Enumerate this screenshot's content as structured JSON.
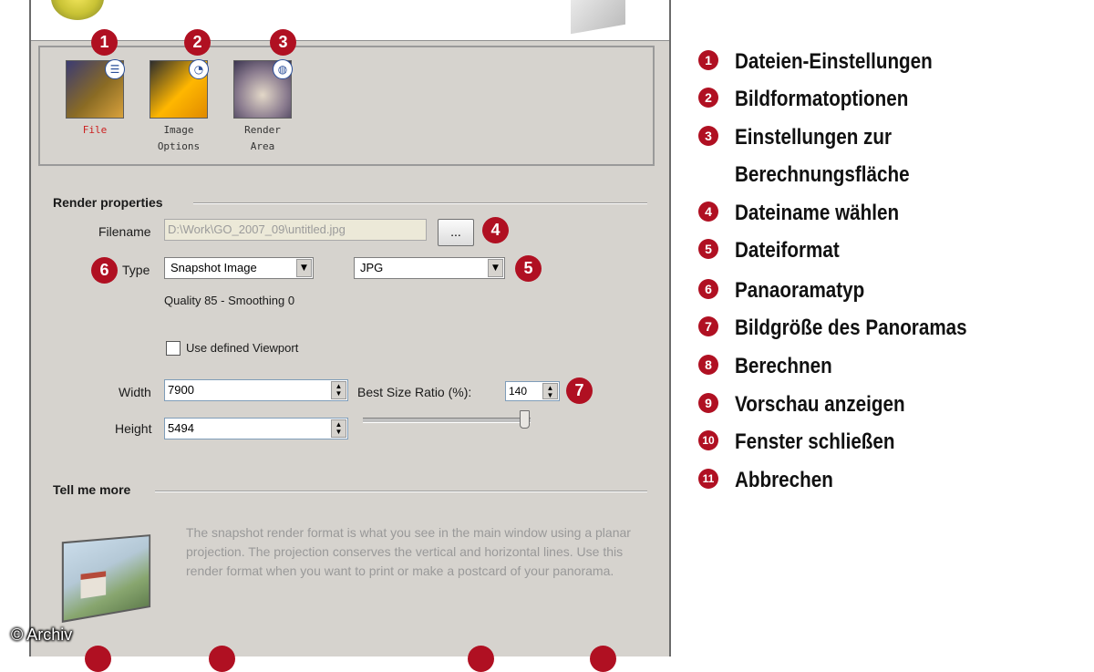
{
  "dialog": {
    "toolbar": [
      {
        "label": "File",
        "badge": "1"
      },
      {
        "label": "Image\nOptions",
        "badge": "2"
      },
      {
        "label": "Render\nArea",
        "badge": "3"
      }
    ],
    "render_properties": {
      "title": "Render properties",
      "filename_label": "Filename",
      "filename_value": "D:\\Work\\GO_2007_09\\untitled.jpg",
      "browse_label": "...",
      "type_label": "Type",
      "type_value": "Snapshot Image",
      "format_value": "JPG",
      "quality_text": "Quality 85 - Smoothing 0",
      "viewport_label": "Use defined Viewport",
      "viewport_checked": false,
      "width_label": "Width",
      "width_value": "7900",
      "height_label": "Height",
      "height_value": "5494",
      "ratio_label": "Best Size Ratio (%):",
      "ratio_value": "140"
    },
    "tell_me_more": {
      "title": "Tell me more",
      "description": "The snapshot render format is what you see in the main window using a planar projection. The projection conserves the vertical and horizontal lines.  Use this render format when you want to print or make a postcard of your panorama."
    }
  },
  "badges": {
    "b4": "4",
    "b5": "5",
    "b6": "6",
    "b7": "7"
  },
  "legend": [
    {
      "num": "1",
      "text": "Dateien-Einstellungen"
    },
    {
      "num": "2",
      "text": "Bildformatoptionen"
    },
    {
      "num": "3",
      "text": "Einstellungen zur"
    },
    {
      "num": "",
      "text": "Berechnungsfläche"
    },
    {
      "num": "4",
      "text": "Dateiname wählen"
    },
    {
      "num": "5",
      "text": "Dateiformat"
    },
    {
      "num": "6",
      "text": "Panaoramatyp"
    },
    {
      "num": "7",
      "text": "Bildgröße des Panoramas"
    },
    {
      "num": "8",
      "text": "Berechnen"
    },
    {
      "num": "9",
      "text": "Vorschau anzeigen"
    },
    {
      "num": "10",
      "text": "Fenster schließen"
    },
    {
      "num": "11",
      "text": "Abbrechen"
    }
  ],
  "credit": "© Archiv",
  "colors": {
    "badge": "#b01022",
    "dialog_bg": "#d6d3ce",
    "file_label": "#cc2020"
  }
}
